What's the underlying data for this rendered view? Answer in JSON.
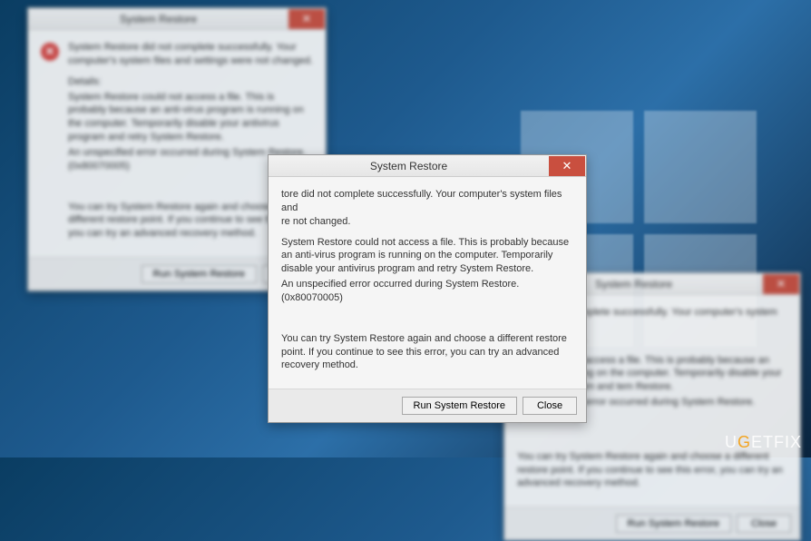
{
  "watermark": {
    "prefix": "U",
    "highlight": "G",
    "suffix": "ETFIX"
  },
  "dialogs": {
    "title": "System Restore",
    "close_label": "✕",
    "error_glyph": "✕",
    "summary": "System Restore did not complete successfully. Your computer's system files and settings were not changed.",
    "summary_short": "tore did not complete successfully. Your computer's system files and\nre not changed.",
    "details_label": "Details:",
    "details_text": "System Restore could not access a file. This is probably because an anti-virus program is running on the computer. Temporarily disable your antivirus program and retry System Restore.",
    "details_text_d3": "stem could not access a file. This is probably because an anti-virus running on the computer. Temporarily disable your antivirus program and tem Restore.",
    "error_code": "An unspecified error occurred during System Restore. (0x80070005)",
    "retry_text": "You can try System Restore again and choose a different restore point. If you continue to see this error, you can try an advanced recovery method.",
    "buttons": {
      "run": "Run System Restore",
      "close": "Close"
    }
  }
}
